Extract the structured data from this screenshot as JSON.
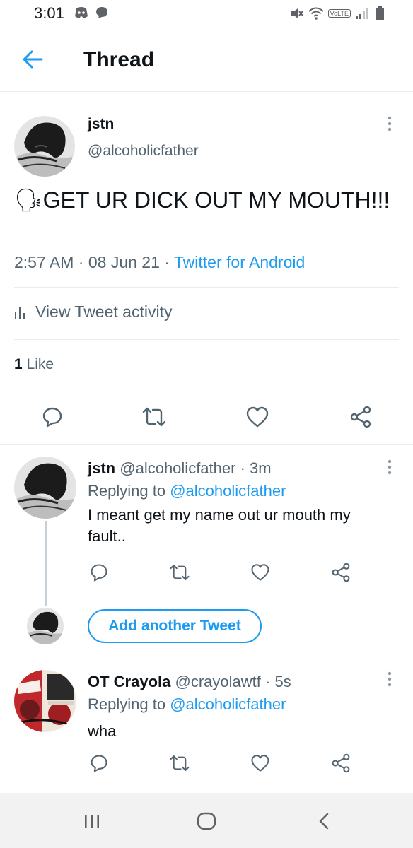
{
  "status_bar": {
    "time": "3:01",
    "volte": "VoLTE"
  },
  "header": {
    "title": "Thread"
  },
  "main_tweet": {
    "name": "jstn",
    "handle": "@alcoholicfather",
    "emoji": "🗣",
    "text": "GET UR DICK OUT MY MOUTH!!!",
    "time": "2:57 AM",
    "date": "08 Jun 21",
    "sep": " · ",
    "source": "Twitter for Android",
    "activity_label": "View Tweet activity",
    "like_count": "1",
    "like_label": "Like"
  },
  "replies": [
    {
      "name": "jstn",
      "handle": "@alcoholicfather",
      "age": "3m",
      "replying_prefix": "Replying to",
      "replying_to": "@alcoholicfather",
      "text": "I meant get my name out ur mouth my fault.."
    },
    {
      "name": "OT Crayola",
      "handle": "@crayolawtf",
      "age": "5s",
      "replying_prefix": "Replying to",
      "replying_to": "@alcoholicfather",
      "text": "wha"
    }
  ],
  "composer": {
    "add_label": "Add another Tweet"
  },
  "icons": {
    "back": "arrow-left-icon",
    "more": "more-vertical-icon",
    "reply": "comment-icon",
    "retweet": "retweet-icon",
    "like": "heart-icon",
    "share": "share-icon",
    "activity": "bar-chart-icon"
  },
  "colors": {
    "accent": "#1d9bf0",
    "text": "#0f1419",
    "secondary": "#536471",
    "divider": "#e6ecf0"
  }
}
